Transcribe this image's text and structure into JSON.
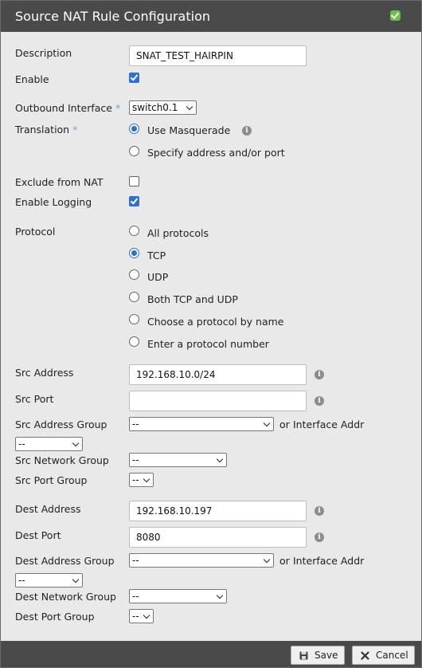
{
  "dialog": {
    "title": "Source NAT Rule Configuration"
  },
  "fields": {
    "description": {
      "label": "Description",
      "value": "SNAT_TEST_HAIRPIN"
    },
    "enable": {
      "label": "Enable",
      "checked": true
    },
    "outbound_interface": {
      "label": "Outbound Interface",
      "required_mark": "*",
      "value": "switch0.1"
    },
    "translation": {
      "label": "Translation",
      "required_mark": "*",
      "options": [
        "Use Masquerade",
        "Specify address and/or port"
      ],
      "selected": "Use Masquerade"
    },
    "exclude_nat": {
      "label": "Exclude from NAT",
      "checked": false
    },
    "enable_logging": {
      "label": "Enable Logging",
      "checked": true
    },
    "protocol": {
      "label": "Protocol",
      "options": [
        "All protocols",
        "TCP",
        "UDP",
        "Both TCP and UDP",
        "Choose a protocol by name",
        "Enter a protocol number"
      ],
      "selected": "TCP"
    },
    "src_address": {
      "label": "Src Address",
      "value": "192.168.10.0/24"
    },
    "src_port": {
      "label": "Src Port",
      "value": ""
    },
    "src_address_group": {
      "label": "Src Address Group",
      "value": "--",
      "or_text": "or",
      "iface_label": "Interface Addr",
      "iface_value": "--"
    },
    "src_network_group": {
      "label": "Src Network Group",
      "value": "--"
    },
    "src_port_group": {
      "label": "Src Port Group",
      "value": "--"
    },
    "dest_address": {
      "label": "Dest Address",
      "value": "192.168.10.197"
    },
    "dest_port": {
      "label": "Dest Port",
      "value": "8080"
    },
    "dest_address_group": {
      "label": "Dest Address Group",
      "value": "--",
      "or_text": "or",
      "iface_label": "Interface Addr",
      "iface_value": "--"
    },
    "dest_network_group": {
      "label": "Dest Network Group",
      "value": "--"
    },
    "dest_port_group": {
      "label": "Dest Port Group",
      "value": "--"
    }
  },
  "footer": {
    "save_label": "Save",
    "cancel_label": "Cancel"
  },
  "icons": {
    "info": "info-icon",
    "save": "floppy-disk-icon",
    "cancel": "x-icon",
    "confirm": "check-icon"
  },
  "info_glyph": "i",
  "colors": {
    "titlebar": "#4a4a4a",
    "accent": "#2d6fd6",
    "required": "#5aa9e6"
  }
}
